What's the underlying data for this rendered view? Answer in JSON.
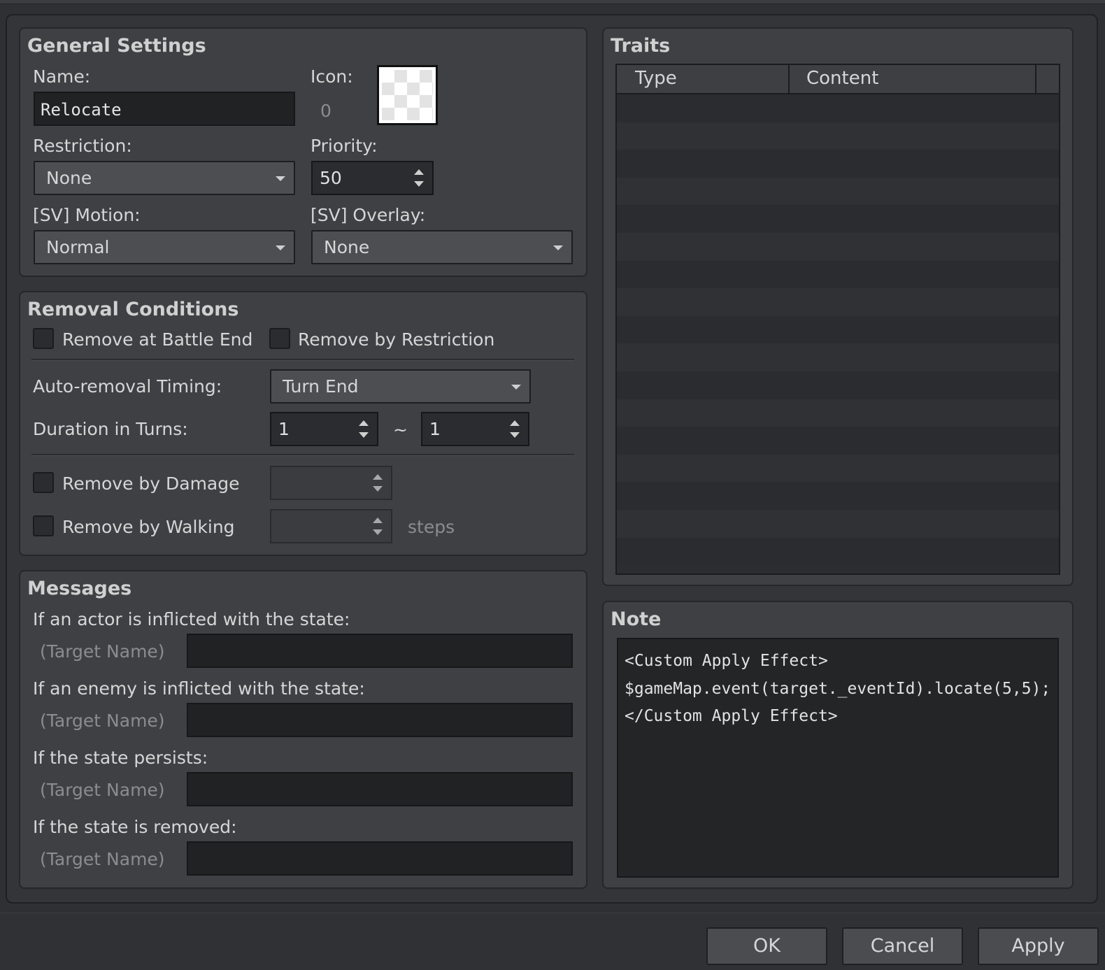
{
  "general": {
    "title": "General Settings",
    "name_label": "Name:",
    "name_value": "Relocate",
    "icon_label": "Icon:",
    "icon_index": "0",
    "restriction_label": "Restriction:",
    "restriction_value": "None",
    "priority_label": "Priority:",
    "priority_value": "50",
    "motion_label": "[SV] Motion:",
    "motion_value": "Normal",
    "overlay_label": "[SV] Overlay:",
    "overlay_value": "None"
  },
  "removal": {
    "title": "Removal Conditions",
    "battle_end_label": "Remove at Battle End",
    "restriction_label": "Remove by Restriction",
    "timing_label": "Auto-removal Timing:",
    "timing_value": "Turn End",
    "duration_label": "Duration in Turns:",
    "duration_min": "1",
    "duration_sep": "~",
    "duration_max": "1",
    "damage_label": "Remove by Damage",
    "walking_label": "Remove by Walking",
    "steps_label": "steps"
  },
  "messages": {
    "title": "Messages",
    "actor_label": "If an actor is inflicted with the state:",
    "enemy_label": "If an enemy is inflicted with the state:",
    "persists_label": "If the state persists:",
    "removed_label": "If the state is removed:",
    "target_name": "(Target Name)"
  },
  "traits": {
    "title": "Traits",
    "col_type": "Type",
    "col_content": "Content"
  },
  "note": {
    "title": "Note",
    "text": "<Custom Apply Effect>\n$gameMap.event(target._eventId).locate(5,5);\n</Custom Apply Effect>"
  },
  "buttons": {
    "ok": "OK",
    "cancel": "Cancel",
    "apply": "Apply"
  }
}
